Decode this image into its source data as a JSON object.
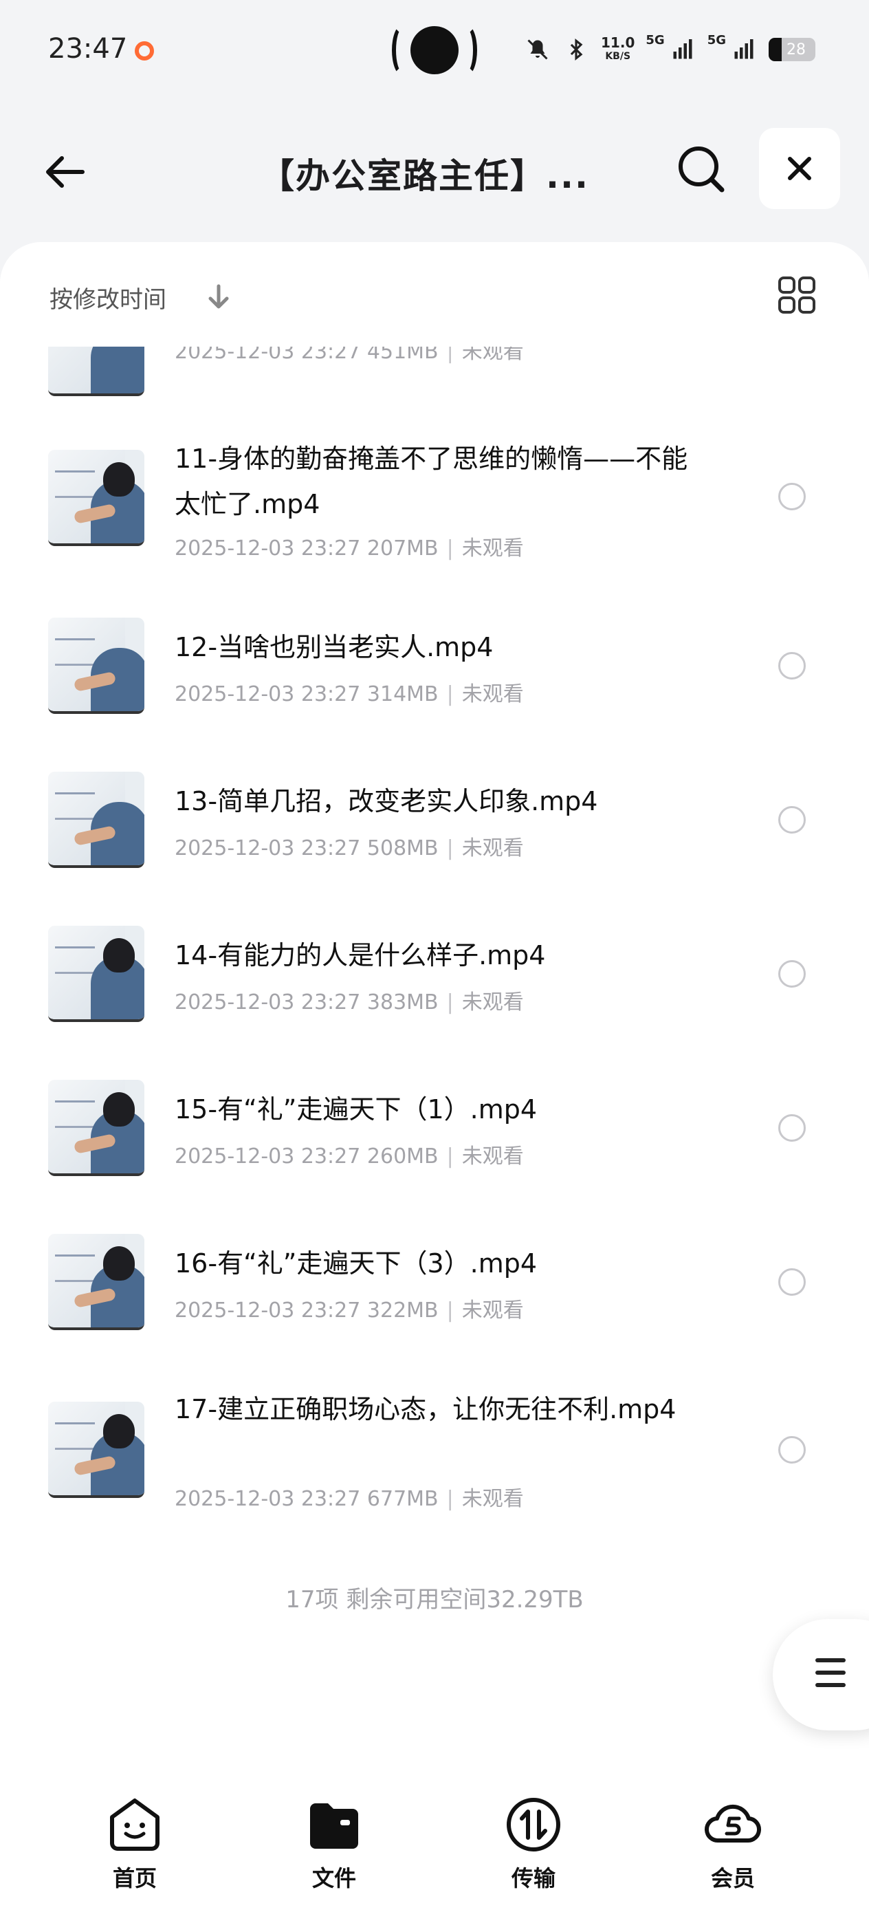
{
  "status_bar": {
    "time": "23:47",
    "net_speed": "11.0",
    "net_speed_unit": "KB/S",
    "net_label_1": "5G",
    "net_label_2": "5G",
    "battery": "28"
  },
  "header": {
    "title": "【办公室路主任】..."
  },
  "sort": {
    "label": "按修改时间"
  },
  "partial_item": {
    "meta_date": "2025-12-03 23:27",
    "meta_size": "451MB",
    "meta_status": "未观看"
  },
  "files": [
    {
      "name": "11-身体的勤奋掩盖不了思维的懒惰——不能太忙了.mp4",
      "date": "2025-12-03 23:27",
      "size": "207MB",
      "status": "未观看"
    },
    {
      "name": "12-当啥也别当老实人.mp4",
      "date": "2025-12-03 23:27",
      "size": "314MB",
      "status": "未观看"
    },
    {
      "name": "13-简单几招，改变老实人印象.mp4",
      "date": "2025-12-03 23:27",
      "size": "508MB",
      "status": "未观看"
    },
    {
      "name": "14-有能力的人是什么样子.mp4",
      "date": "2025-12-03 23:27",
      "size": "383MB",
      "status": "未观看"
    },
    {
      "name": "15-有“礼”走遍天下（1）.mp4",
      "date": "2025-12-03 23:27",
      "size": "260MB",
      "status": "未观看"
    },
    {
      "name": "16-有“礼”走遍天下（3）.mp4",
      "date": "2025-12-03 23:27",
      "size": "322MB",
      "status": "未观看"
    },
    {
      "name": "17-建立正确职场心态，让你无往不利.mp4",
      "date": "2025-12-03 23:27",
      "size": "677MB",
      "status": "未观看"
    }
  ],
  "summary": "17项 剩余可用空间32.29TB",
  "bottom_nav": {
    "home": "首页",
    "files": "文件",
    "transfer": "传输",
    "member": "会员"
  },
  "colors": {
    "accent_record": "#ff6b35",
    "page_bg": "#f3f4f6",
    "meta_text": "#a3a3a8"
  }
}
